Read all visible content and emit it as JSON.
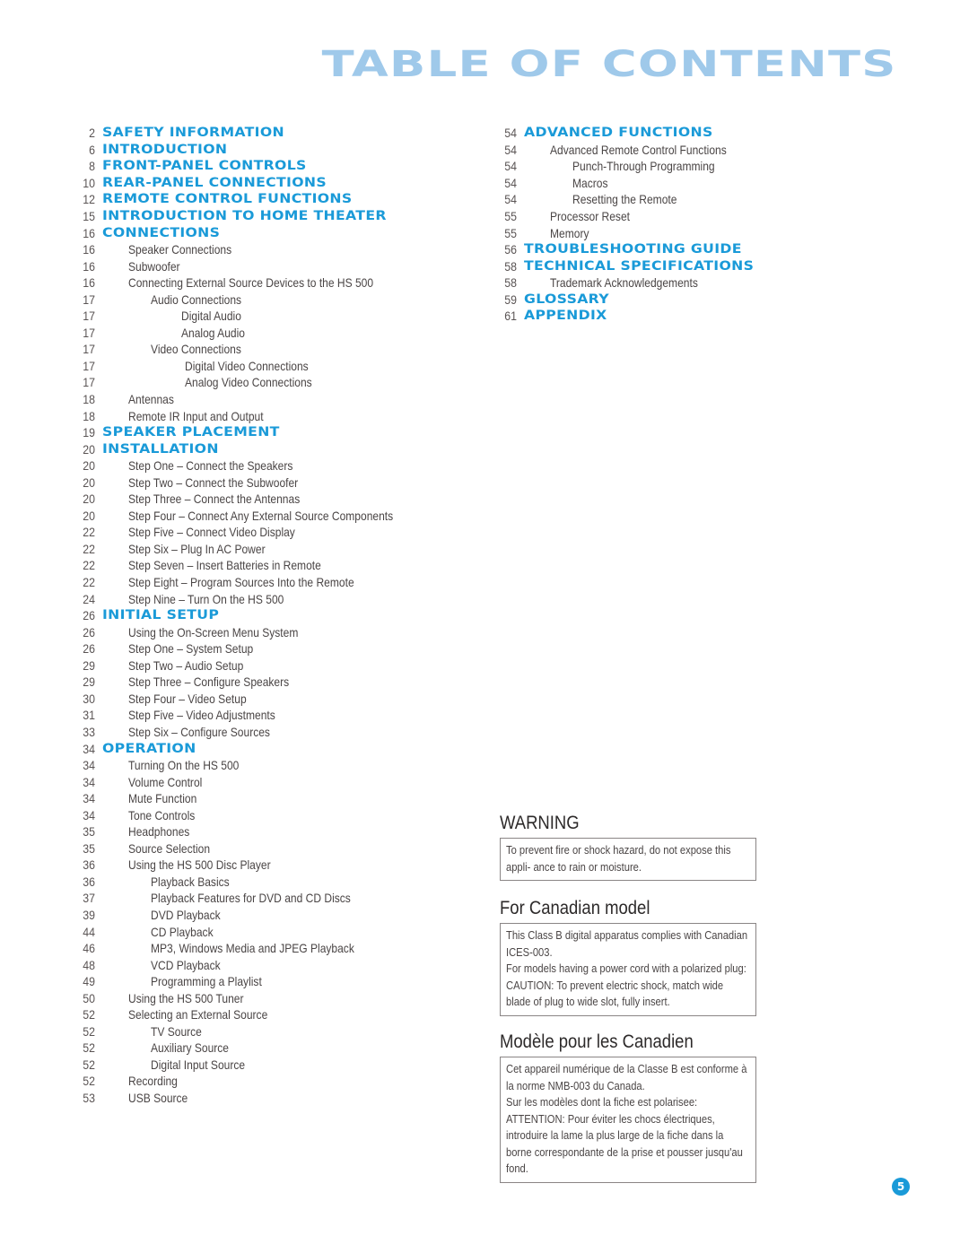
{
  "header": {
    "title": "TABLE OF CONTENTS"
  },
  "toc_left": [
    {
      "page": "2",
      "label": "SAFETY INFORMATION",
      "level": 0
    },
    {
      "page": "6",
      "label": "INTRODUCTION",
      "level": 0
    },
    {
      "page": "8",
      "label": "FRONT-PANEL CONTROLS",
      "level": 0
    },
    {
      "page": "10",
      "label": "REAR-PANEL CONNECTIONS",
      "level": 0
    },
    {
      "page": "12",
      "label": "REMOTE CONTROL FUNCTIONS",
      "level": 0
    },
    {
      "page": "15",
      "label": "INTRODUCTION TO HOME THEATER",
      "level": 0
    },
    {
      "page": "16",
      "label": "CONNECTIONS",
      "level": 0
    },
    {
      "page": "16",
      "label": "Speaker Connections",
      "level": 1
    },
    {
      "page": "16",
      "label": "Subwoofer",
      "level": 1
    },
    {
      "page": "16",
      "label": "Connecting External Source Devices to the HS 500",
      "level": 1
    },
    {
      "page": "17",
      "label": "Audio Connections",
      "level": 2
    },
    {
      "page": "17",
      "label": "Digital Audio",
      "level": 3
    },
    {
      "page": "17",
      "label": "Analog Audio",
      "level": 3
    },
    {
      "page": "17",
      "label": "Video Connections",
      "level": 2
    },
    {
      "page": "17",
      "label": "Digital Video Connections",
      "level": 4
    },
    {
      "page": "17",
      "label": "Analog Video Connections",
      "level": 4
    },
    {
      "page": "18",
      "label": "Antennas",
      "level": 1
    },
    {
      "page": "18",
      "label": "Remote IR Input and Output",
      "level": 1
    },
    {
      "page": "19",
      "label": "SPEAKER PLACEMENT",
      "level": 0
    },
    {
      "page": "20",
      "label": "INSTALLATION",
      "level": 0
    },
    {
      "page": "20",
      "label": "Step One – Connect the Speakers",
      "level": 1
    },
    {
      "page": "20",
      "label": "Step Two – Connect the Subwoofer",
      "level": 1
    },
    {
      "page": "20",
      "label": "Step Three – Connect the Antennas",
      "level": 1
    },
    {
      "page": "20",
      "label": "Step Four – Connect Any External Source Components",
      "level": 1
    },
    {
      "page": "22",
      "label": "Step Five – Connect Video Display",
      "level": 1
    },
    {
      "page": "22",
      "label": "Step Six – Plug In AC Power",
      "level": 1
    },
    {
      "page": "22",
      "label": "Step Seven – Insert Batteries in Remote",
      "level": 1
    },
    {
      "page": "22",
      "label": "Step Eight – Program Sources Into the Remote",
      "level": 1
    },
    {
      "page": "24",
      "label": "Step Nine – Turn On the HS 500",
      "level": 1
    },
    {
      "page": "26",
      "label": "INITIAL SETUP",
      "level": 0
    },
    {
      "page": "26",
      "label": "Using the On-Screen Menu System",
      "level": 1
    },
    {
      "page": "26",
      "label": "Step One – System Setup",
      "level": 1
    },
    {
      "page": "29",
      "label": "Step Two – Audio Setup",
      "level": 1
    },
    {
      "page": "29",
      "label": "Step Three – Configure Speakers",
      "level": 1
    },
    {
      "page": "30",
      "label": "Step Four – Video Setup",
      "level": 1
    },
    {
      "page": "31",
      "label": "Step Five – Video Adjustments",
      "level": 1
    },
    {
      "page": "33",
      "label": "Step Six – Configure Sources",
      "level": 1
    },
    {
      "page": "34",
      "label": "OPERATION",
      "level": 0
    },
    {
      "page": "34",
      "label": "Turning On the HS 500",
      "level": 1
    },
    {
      "page": "34",
      "label": "Volume Control",
      "level": 1
    },
    {
      "page": "34",
      "label": "Mute Function",
      "level": 1
    },
    {
      "page": "34",
      "label": "Tone Controls",
      "level": 1
    },
    {
      "page": "35",
      "label": "Headphones",
      "level": 1
    },
    {
      "page": "35",
      "label": "Source Selection",
      "level": 1
    },
    {
      "page": "36",
      "label": "Using the HS 500 Disc Player",
      "level": 1
    },
    {
      "page": "36",
      "label": "Playback Basics",
      "level": 2
    },
    {
      "page": "37",
      "label": "Playback Features for DVD and CD Discs",
      "level": 2
    },
    {
      "page": "39",
      "label": "DVD Playback",
      "level": 2
    },
    {
      "page": "44",
      "label": "CD Playback",
      "level": 2
    },
    {
      "page": "46",
      "label": "MP3, Windows Media and JPEG Playback",
      "level": 2
    },
    {
      "page": "48",
      "label": "VCD Playback",
      "level": 2
    },
    {
      "page": "49",
      "label": "Programming a Playlist",
      "level": 2
    },
    {
      "page": "50",
      "label": "Using the HS 500 Tuner",
      "level": 1
    },
    {
      "page": "52",
      "label": "Selecting an External Source",
      "level": 1
    },
    {
      "page": "52",
      "label": "TV Source",
      "level": 2
    },
    {
      "page": "52",
      "label": "Auxiliary Source",
      "level": 2
    },
    {
      "page": "52",
      "label": "Digital Input Source",
      "level": 2
    },
    {
      "page": "52",
      "label": "Recording",
      "level": 1
    },
    {
      "page": "53",
      "label": "USB Source",
      "level": 1
    }
  ],
  "toc_right": [
    {
      "page": "54",
      "label": "ADVANCED FUNCTIONS",
      "level": 0
    },
    {
      "page": "54",
      "label": "Advanced Remote Control Functions",
      "level": 1
    },
    {
      "page": "54",
      "label": "Punch-Through Programming",
      "level": 2
    },
    {
      "page": "54",
      "label": "Macros",
      "level": 2
    },
    {
      "page": "54",
      "label": "Resetting the Remote",
      "level": 2
    },
    {
      "page": "55",
      "label": "Processor Reset",
      "level": 1
    },
    {
      "page": "55",
      "label": "Memory",
      "level": 1
    },
    {
      "page": "56",
      "label": "TROUBLESHOOTING GUIDE",
      "level": 0
    },
    {
      "page": "58",
      "label": "TECHNICAL SPECIFICATIONS",
      "level": 0
    },
    {
      "page": "58",
      "label": "Trademark Acknowledgements",
      "level": 1
    },
    {
      "page": "59",
      "label": "GLOSSARY",
      "level": 0
    },
    {
      "page": "61",
      "label": "APPENDIX",
      "level": 0
    }
  ],
  "notices": {
    "warning": {
      "heading": "WARNING",
      "lines": [
        "To prevent fire or shock hazard, do not expose this appli- ance to rain or moisture."
      ]
    },
    "canadian": {
      "heading": "For Canadian model",
      "lines": [
        "This Class B digital apparatus complies with Canadian ICES-003.",
        "For models having a power cord with a polarized plug: CAUTION: To prevent electric shock, match wide blade of plug to wide slot, fully insert."
      ]
    },
    "canadien_fr": {
      "heading": "Modèle pour les Canadien",
      "lines": [
        "Cet appareil numérique de la Classe B est conforme à la norme NMB-003 du Canada.",
        "Sur les modèles dont la fiche est polarisee: ATTENTION: Pour éviter les chocs électriques, introduire la lame la plus large de la fiche dans la borne correspondante de la prise et pousser jusqu'au fond."
      ]
    }
  },
  "footer": {
    "page_number": "5",
    "accent_color": "#1a9ad8",
    "title_color": "#9fc9ea"
  }
}
